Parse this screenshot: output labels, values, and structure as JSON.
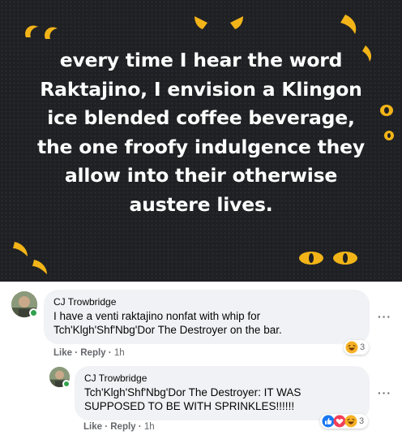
{
  "post": {
    "text": "every time I hear the word\nRaktajino, I envision a Klingon\nice blended coffee beverage,\nthe one froofy indulgence they\nallow into their otherwise\naustere lives.",
    "background_color": "#1f2023",
    "decoration_color": "#f2b418"
  },
  "comments": [
    {
      "author": "CJ Trowbridge",
      "text": "I have a venti raktajino nonfat with whip for Tch'Klgh'Shf'Nbg'Dor The Destroyer on the bar.",
      "like_label": "Like",
      "reply_label": "Reply",
      "time": "1h",
      "more_label": "···",
      "reactions": {
        "icons": [
          "haha-icon"
        ],
        "count": "3"
      }
    },
    {
      "author": "CJ Trowbridge",
      "text": "Tch'Klgh'Shf'Nbg'Dor The Destroyer: IT WAS SUPPOSED TO BE WITH SPRINKLES!!!!!!",
      "like_label": "Like",
      "reply_label": "Reply",
      "time": "1h",
      "more_label": "···",
      "reactions": {
        "icons": [
          "like-icon",
          "love-icon",
          "haha-icon"
        ],
        "count": "3"
      }
    }
  ]
}
